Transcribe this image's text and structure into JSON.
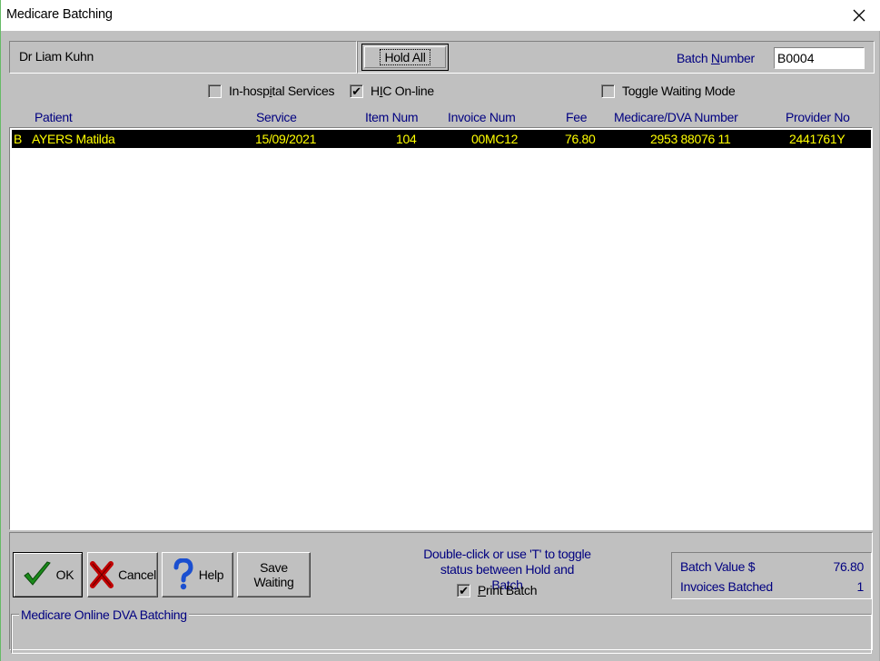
{
  "window": {
    "title": "Medicare Batching",
    "close_icon": "close-icon"
  },
  "header": {
    "doctor": "Dr Liam Kuhn",
    "hold_all_label": "Hold All",
    "batch_number_label": "Batch Number",
    "batch_number_value": "B0004"
  },
  "options": {
    "in_hospital_label": "In-hospital Services",
    "in_hospital_checked": false,
    "hic_online_label": "HIC On-line",
    "hic_online_checked": true,
    "toggle_waiting_label": "Toggle Waiting Mode",
    "toggle_waiting_checked": false
  },
  "table": {
    "columns": [
      "Patient",
      "Service",
      "Item Num",
      "Invoice Num",
      "Fee",
      "Medicare/DVA Number",
      "Provider No"
    ],
    "rows": [
      {
        "status": "B",
        "patient": "AYERS Matilda",
        "service": "15/09/2021",
        "item": "104",
        "invoice": "00MC12",
        "fee": "76.80",
        "medicare": "2953 88076 11",
        "provider": "2441761Y"
      }
    ]
  },
  "buttons": {
    "ok": "OK",
    "cancel": "Cancel",
    "help": "Help",
    "save_line1": "Save",
    "save_line2": "Waiting"
  },
  "hint": {
    "line1": "Double-click or use 'T' to toggle",
    "line2": "status between Hold and Batch"
  },
  "print_batch": {
    "label": "Print Batch",
    "checked": true
  },
  "summary": {
    "batch_value_label": "Batch Value $",
    "batch_value": "76.80",
    "invoices_label": "Invoices Batched",
    "invoices_count": "1"
  },
  "status": {
    "group_label": "Medicare Online DVA Batching"
  },
  "colors": {
    "header_text": "#000080",
    "selected_row_bg": "#000000",
    "selected_row_text": "#ffff00",
    "face": "#c0c0c0"
  }
}
